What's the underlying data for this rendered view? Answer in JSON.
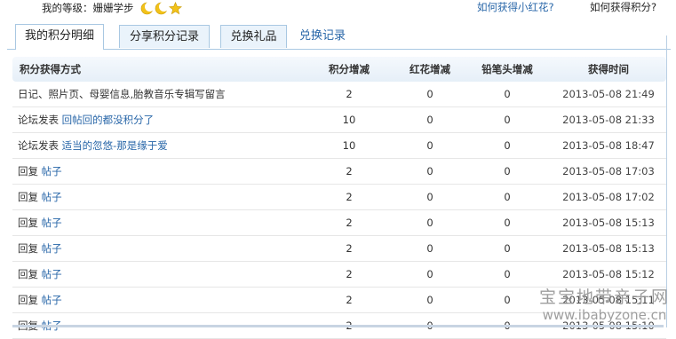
{
  "header": {
    "level_label": "我的等级：",
    "level_name": "姗姗学步",
    "badge_icons": [
      "moon-icon",
      "moon-icon",
      "star-icon"
    ],
    "link_flower": "如何获得小红花?",
    "link_points": "如何获得积分?"
  },
  "tabs": [
    {
      "label": "我的积分明细",
      "active": true
    },
    {
      "label": "分享积分记录",
      "active": false
    },
    {
      "label": "兑换礼品",
      "active": false
    },
    {
      "label": "兑换记录",
      "active": false
    }
  ],
  "table": {
    "columns": [
      "积分获得方式",
      "积分增减",
      "红花增减",
      "铅笔头增减",
      "获得时间"
    ],
    "rows": [
      {
        "type": "日记、照片页、母婴信息,胎教音乐专辑写留言",
        "link": "",
        "points": "2",
        "flowers": "0",
        "pencils": "0",
        "time": "2013-05-08 21:49"
      },
      {
        "type": "论坛发表",
        "link": "回帖回的都没积分了",
        "points": "10",
        "flowers": "0",
        "pencils": "0",
        "time": "2013-05-08 21:33"
      },
      {
        "type": "论坛发表",
        "link": "适当的忽悠-那是缘于爱",
        "points": "10",
        "flowers": "0",
        "pencils": "0",
        "time": "2013-05-08 18:47"
      },
      {
        "type": "回复",
        "link": "帖子",
        "points": "2",
        "flowers": "0",
        "pencils": "0",
        "time": "2013-05-08 17:03"
      },
      {
        "type": "回复",
        "link": "帖子",
        "points": "2",
        "flowers": "0",
        "pencils": "0",
        "time": "2013-05-08 17:02"
      },
      {
        "type": "回复",
        "link": "帖子",
        "points": "2",
        "flowers": "0",
        "pencils": "0",
        "time": "2013-05-08 15:13"
      },
      {
        "type": "回复",
        "link": "帖子",
        "points": "2",
        "flowers": "0",
        "pencils": "0",
        "time": "2013-05-08 15:13"
      },
      {
        "type": "回复",
        "link": "帖子",
        "points": "2",
        "flowers": "0",
        "pencils": "0",
        "time": "2013-05-08 15:12"
      },
      {
        "type": "回复",
        "link": "帖子",
        "points": "2",
        "flowers": "0",
        "pencils": "0",
        "time": "2013-05-08 15:11"
      },
      {
        "type": "回复",
        "link": "帖子",
        "points": "2",
        "flowers": "0",
        "pencils": "0",
        "time": "2013-05-08 15:10"
      }
    ]
  },
  "watermark": {
    "text_cn": "宝宝地带亲子网",
    "url": "www.ibabyzone.cn"
  },
  "colors": {
    "link": "#2866a8",
    "tab_border": "#a9c8e2",
    "header_bg": "#e6eff8",
    "badge_yellow": "#f2c21a"
  }
}
